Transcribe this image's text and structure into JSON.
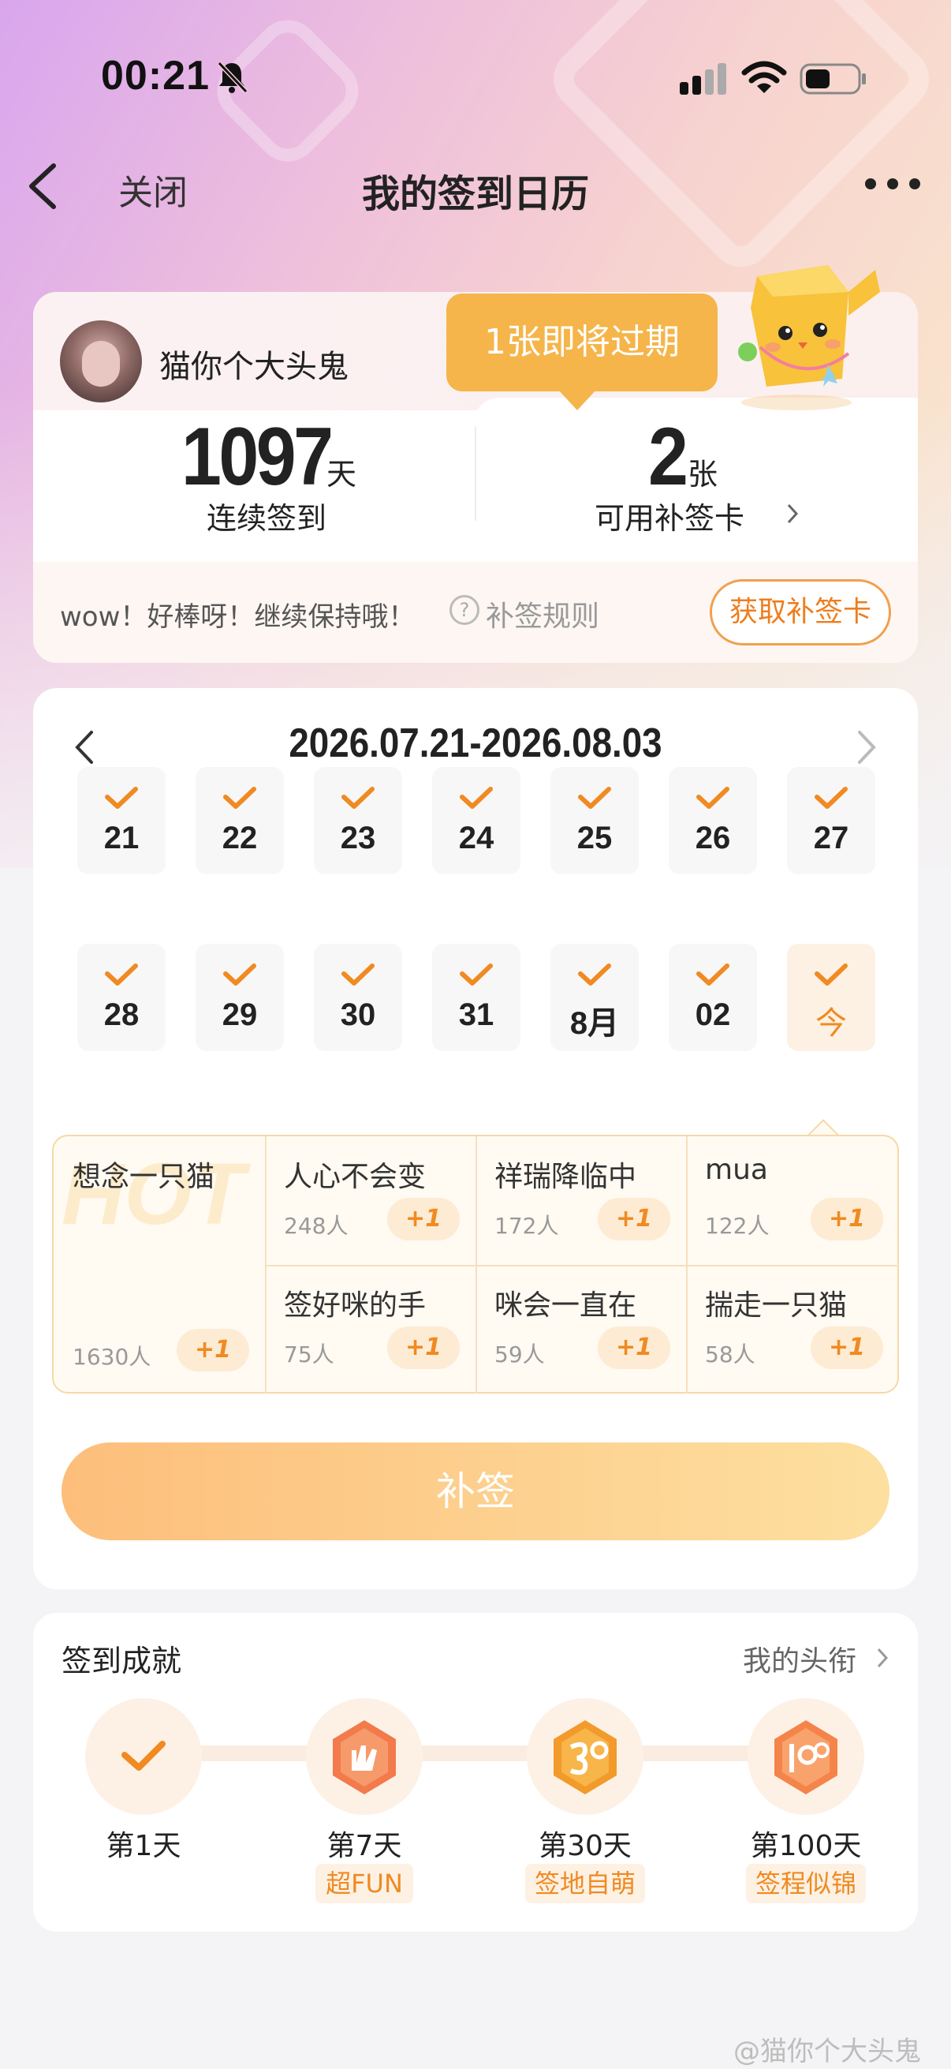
{
  "status_bar": {
    "time": "00:21"
  },
  "nav": {
    "close_label": "关闭",
    "title": "我的签到日历"
  },
  "profile": {
    "username": "猫你个大头鬼",
    "streak_value": "1097",
    "streak_unit": "天",
    "streak_label": "连续签到",
    "cards_value": "2",
    "cards_unit": "张",
    "cards_label": "可用补签卡",
    "expire_tip": "1张即将过期",
    "encourage": "wow！好棒呀！继续保持哦！",
    "rules_label": "补签规则",
    "get_card_label": "获取补签卡"
  },
  "calendar": {
    "range": "2026.07.21-2026.08.03",
    "days": [
      {
        "label": "21",
        "checked": true
      },
      {
        "label": "22",
        "checked": true
      },
      {
        "label": "23",
        "checked": true
      },
      {
        "label": "24",
        "checked": true
      },
      {
        "label": "25",
        "checked": true
      },
      {
        "label": "26",
        "checked": true
      },
      {
        "label": "27",
        "checked": true
      },
      {
        "label": "28",
        "checked": true
      },
      {
        "label": "29",
        "checked": true
      },
      {
        "label": "30",
        "checked": true
      },
      {
        "label": "31",
        "checked": true
      },
      {
        "label": "8月",
        "checked": true
      },
      {
        "label": "02",
        "checked": true
      },
      {
        "label": "今",
        "checked": true,
        "today": true
      }
    ]
  },
  "tags": {
    "hot_watermark": "HOT",
    "plus_label": "+1",
    "items": [
      {
        "name": "想念一只猫",
        "count": "1630人"
      },
      {
        "name": "人心不会变",
        "count": "248人"
      },
      {
        "name": "祥瑞降临中",
        "count": "172人"
      },
      {
        "name": "mua",
        "count": "122人"
      },
      {
        "name": "签好咪的手",
        "count": "75人"
      },
      {
        "name": "咪会一直在",
        "count": "59人"
      },
      {
        "name": "揣走一只猫",
        "count": "58人"
      }
    ]
  },
  "sign_button": "补签",
  "achievements": {
    "title": "签到成就",
    "link": "我的头衔",
    "items": [
      {
        "day": "第1天",
        "badge": ""
      },
      {
        "day": "第7天",
        "badge": "超FUN"
      },
      {
        "day": "第30天",
        "badge": "签地自萌"
      },
      {
        "day": "第100天",
        "badge": "签程似锦"
      }
    ]
  },
  "watermark": "@猫你个大头鬼",
  "colors": {
    "accent": "#f08a21",
    "tip": "#f5b54a",
    "button_start": "#fdbe7b",
    "button_end": "#fde0a0"
  }
}
